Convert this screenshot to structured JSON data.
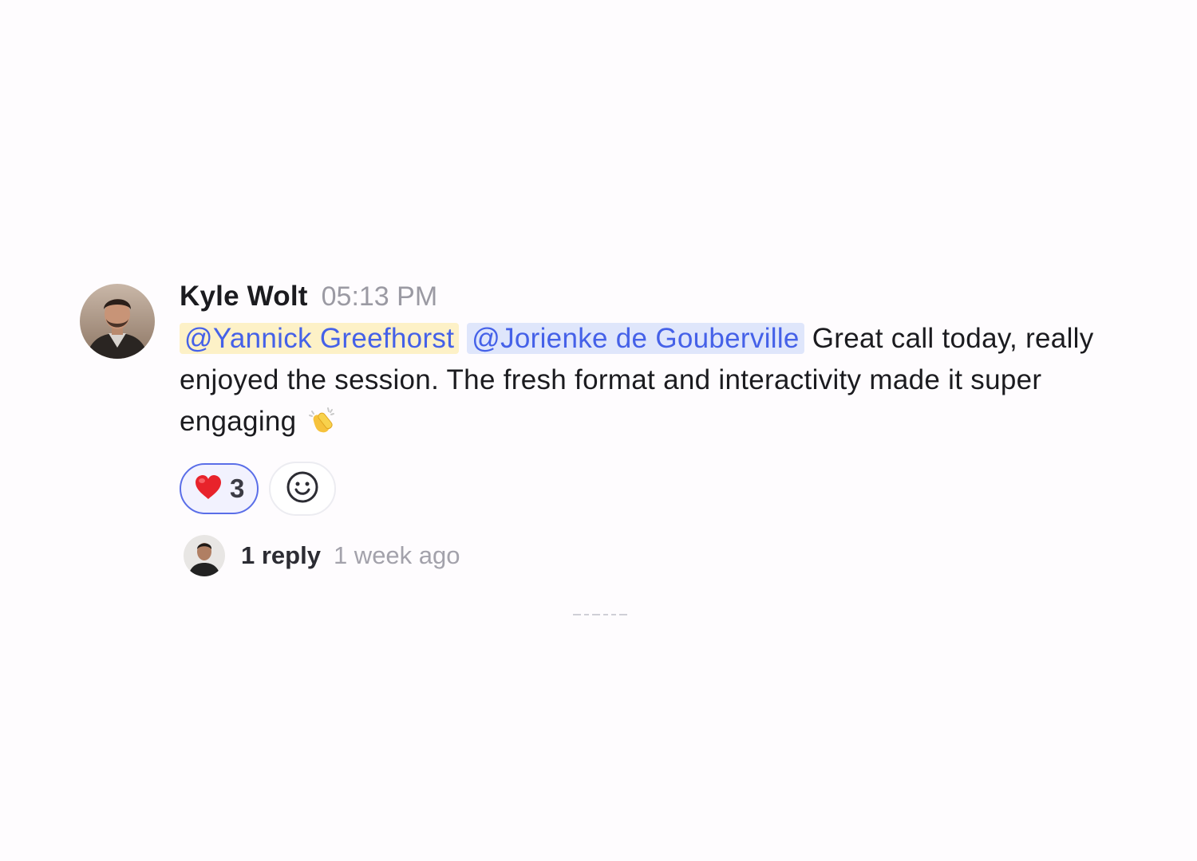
{
  "message": {
    "author": "Kyle Wolt",
    "time": "05:13 PM",
    "mentions": [
      "@Yannick Greefhorst",
      "@Jorienke de Gouberville"
    ],
    "text": "Great call today, really enjoyed the session. The fresh format and interactivity made it super engaging",
    "inline_emoji": "clapping-hands",
    "reactions": [
      {
        "emoji": "heart",
        "count": "3",
        "active": true
      }
    ],
    "add_reaction_icon": "smiley-face-icon",
    "thread": {
      "reply_count": "1 reply",
      "last_reply": "1 week ago"
    }
  },
  "colors": {
    "mention_text": "#4561e8",
    "mention_self_bg": "#fdf1c7",
    "mention_other_bg": "#dfe6fb",
    "reaction_active_border": "#5a6ee8"
  }
}
